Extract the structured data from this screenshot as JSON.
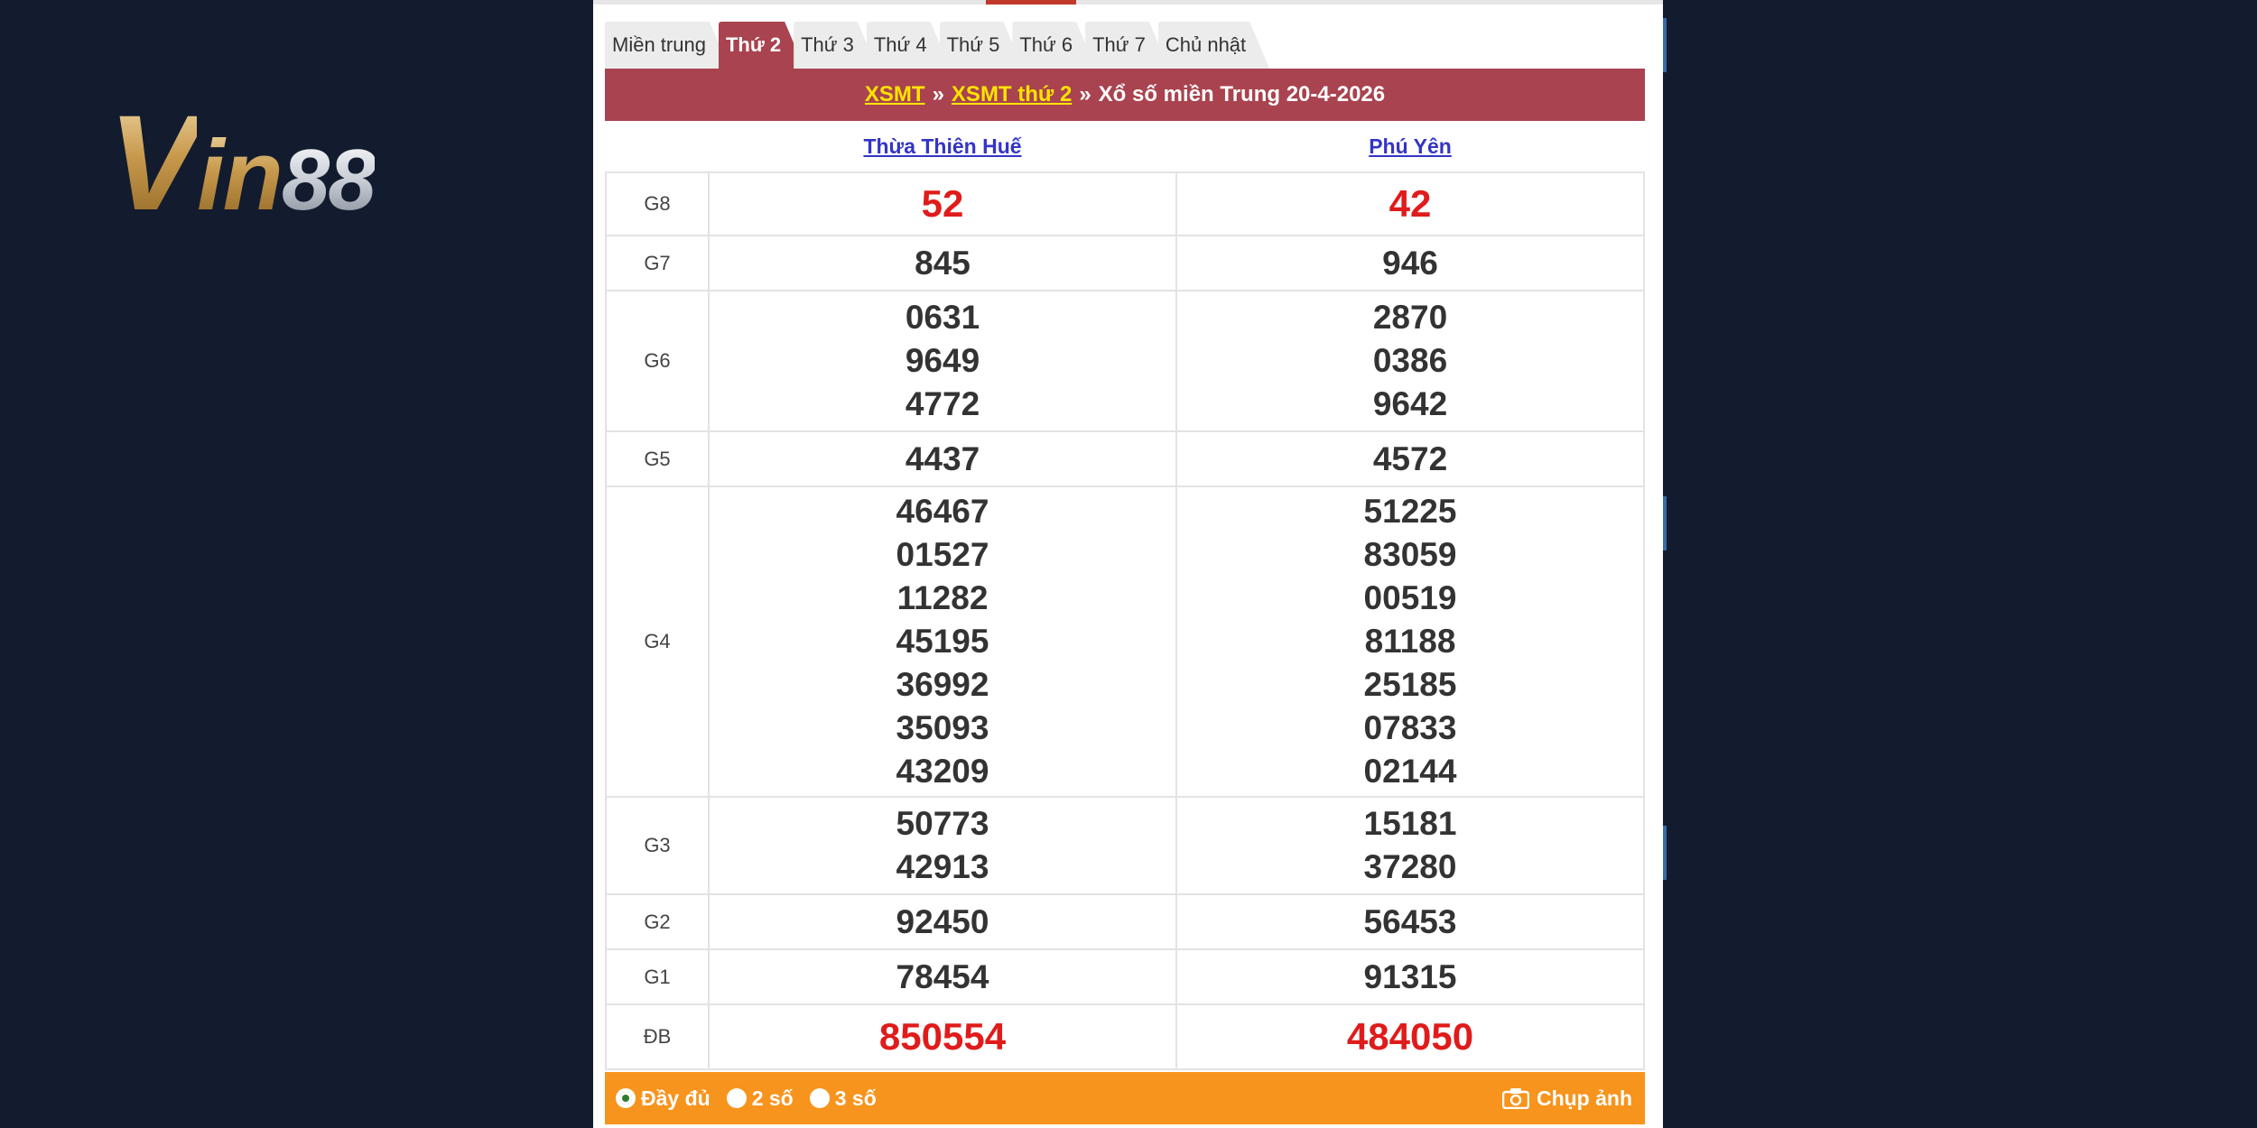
{
  "logo": {
    "v": "V",
    "in": "in",
    "num": "88"
  },
  "tabs": [
    "Miền trung",
    "Thứ 2",
    "Thứ 3",
    "Thứ 4",
    "Thứ 5",
    "Thứ 6",
    "Thứ 7",
    "Chủ nhật"
  ],
  "active_tab": "Thứ 2",
  "breadcrumb": {
    "link1": "XSMT",
    "sep1": "»",
    "link2": "XSMT thứ 2",
    "sep2": "»",
    "text": "Xổ số miền Trung 20-4-2026"
  },
  "provinces": [
    "Thừa Thiên Huế",
    "Phú Yên"
  ],
  "prizes": [
    {
      "label": "G8",
      "col1": [
        "52"
      ],
      "col2": [
        "42"
      ],
      "highlight": true
    },
    {
      "label": "G7",
      "col1": [
        "845"
      ],
      "col2": [
        "946"
      ]
    },
    {
      "label": "G6",
      "col1": [
        "0631",
        "9649",
        "4772"
      ],
      "col2": [
        "2870",
        "0386",
        "9642"
      ]
    },
    {
      "label": "G5",
      "col1": [
        "4437"
      ],
      "col2": [
        "4572"
      ]
    },
    {
      "label": "G4",
      "col1": [
        "46467",
        "01527",
        "11282",
        "45195",
        "36992",
        "35093",
        "43209"
      ],
      "col2": [
        "51225",
        "83059",
        "00519",
        "81188",
        "25185",
        "07833",
        "02144"
      ]
    },
    {
      "label": "G3",
      "col1": [
        "50773",
        "42913"
      ],
      "col2": [
        "15181",
        "37280"
      ]
    },
    {
      "label": "G2",
      "col1": [
        "92450"
      ],
      "col2": [
        "56453"
      ]
    },
    {
      "label": "G1",
      "col1": [
        "78454"
      ],
      "col2": [
        "91315"
      ]
    },
    {
      "label": "ĐB",
      "col1": [
        "850554"
      ],
      "col2": [
        "484050"
      ],
      "highlight": true
    }
  ],
  "footer": {
    "options": [
      "Đầy đủ",
      "2 số",
      "3 số"
    ],
    "selected": "Đầy đủ",
    "capture_label": "Chụp ảnh"
  },
  "colors": {
    "accent": "#a9434f",
    "footer": "#f7941d",
    "highlight": "#e01b1b",
    "link_yellow": "#ffe400"
  }
}
